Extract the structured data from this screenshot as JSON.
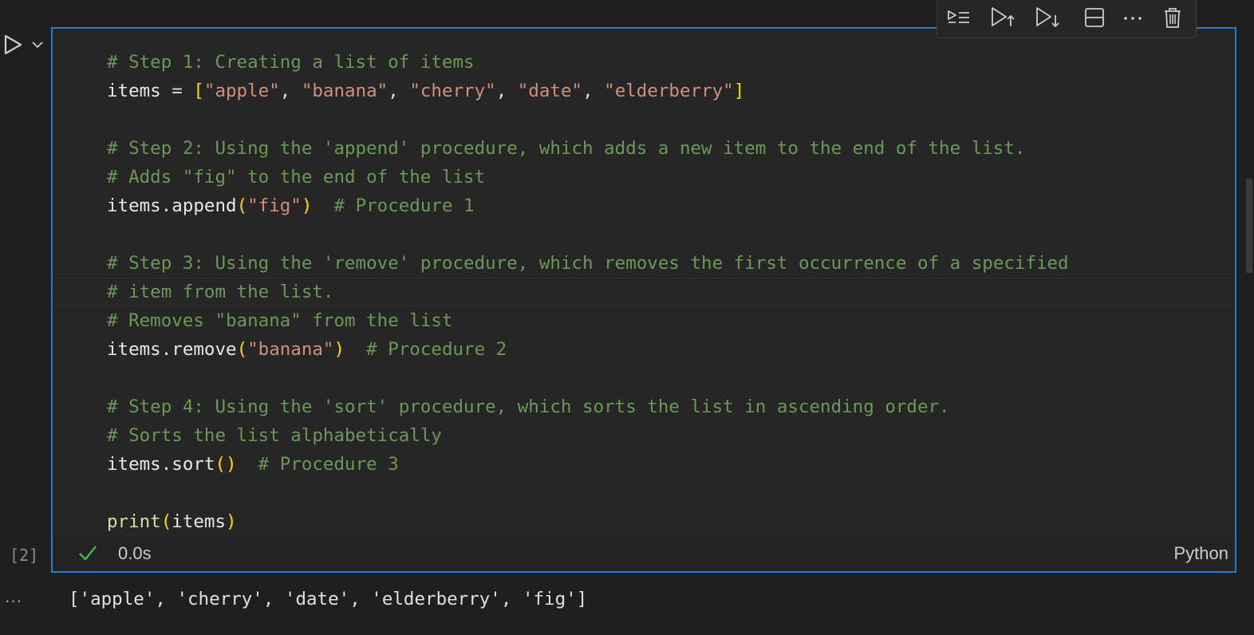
{
  "cell": {
    "execution_count": "[2]",
    "duration": "0.0s",
    "language": "Python",
    "code_lines": [
      "# Step 1: Creating a list of items",
      "items = [\"apple\", \"banana\", \"cherry\", \"date\", \"elderberry\"]",
      "",
      "# Step 2: Using the 'append' procedure, which adds a new item to the end of the list.",
      "# Adds \"fig\" to the end of the list",
      "items.append(\"fig\")  # Procedure 1",
      "",
      "# Step 3: Using the 'remove' procedure, which removes the first occurrence of a specified",
      "# item from the list.",
      "# Removes \"banana\" from the list",
      "items.remove(\"banana\")  # Procedure 2",
      "",
      "# Step 4: Using the 'sort' procedure, which sorts the list in ascending order.",
      "# Sorts the list alphabetically",
      "items.sort()  # Procedure 3",
      "",
      "print(items)"
    ],
    "status": "success"
  },
  "output": {
    "text": "['apple', 'cherry', 'date', 'elderberry', 'fig']",
    "more_label": "···"
  },
  "toolbar": {
    "buttons": [
      {
        "name": "execute-above-and-cell-icon"
      },
      {
        "name": "execute-above-icon"
      },
      {
        "name": "execute-below-icon"
      },
      {
        "name": "split-cell-icon"
      },
      {
        "name": "more-actions-icon"
      },
      {
        "name": "delete-cell-icon"
      }
    ]
  },
  "colors": {
    "accent_border": "#1e7fd0",
    "comment": "#6a9955",
    "string": "#ce9178",
    "bracket": "#ffd700",
    "function": "#dcdcaa",
    "check": "#3fb950"
  }
}
